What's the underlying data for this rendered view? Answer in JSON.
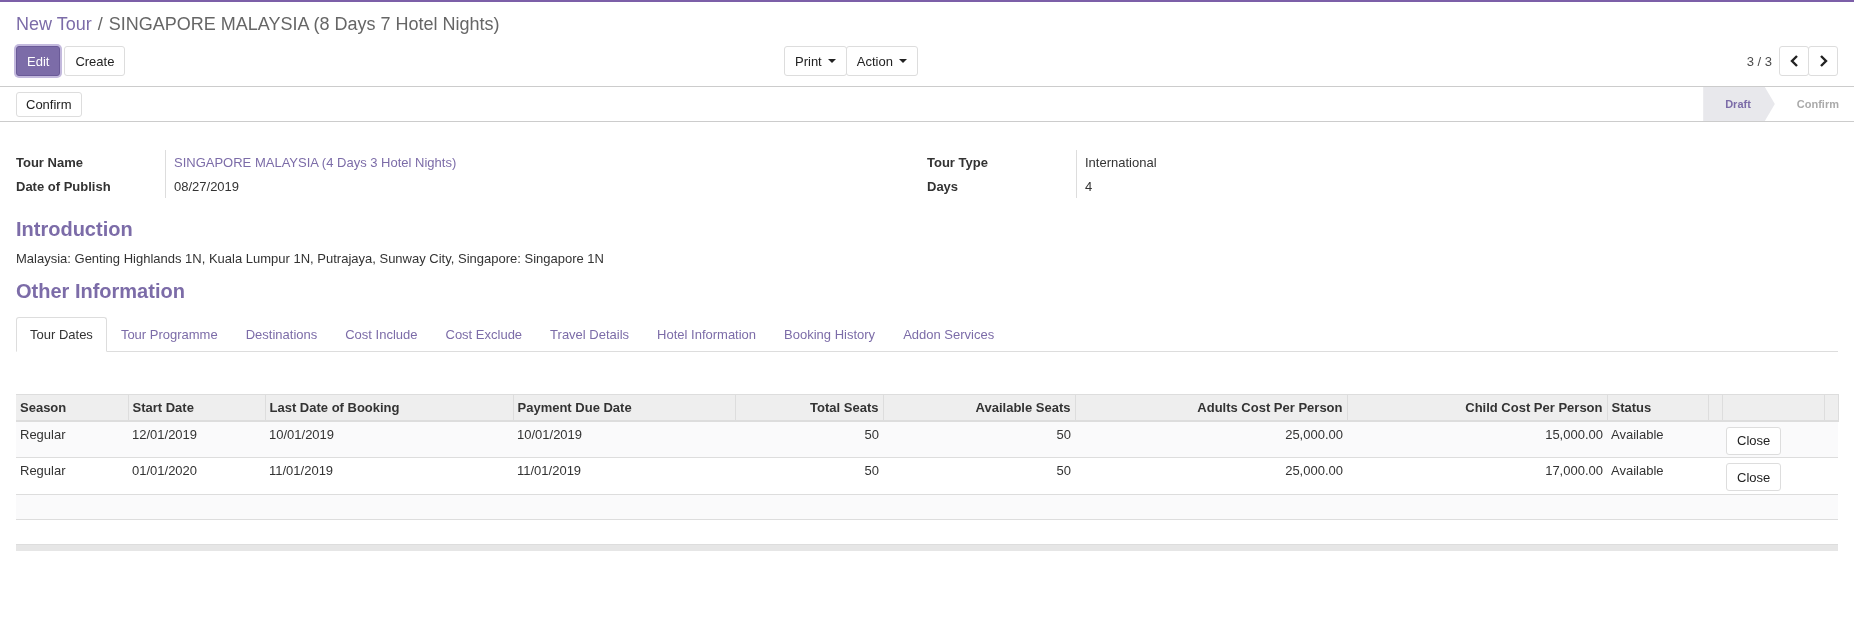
{
  "breadcrumb": {
    "parent": "New Tour",
    "separator": "/",
    "current": "SINGAPORE MALAYSIA (8 Days 7 Hotel Nights)"
  },
  "buttons": [
    {
      "label": "Edit",
      "kind": "primary"
    },
    {
      "label": "Create",
      "kind": "secondary"
    }
  ],
  "menus": [
    {
      "label": "Print"
    },
    {
      "label": "Action"
    }
  ],
  "pager": {
    "value": "3 / 3"
  },
  "header_buttons": [
    "Confirm"
  ],
  "stages": [
    {
      "label": "Draft",
      "selected": true
    },
    {
      "label": "Confirm",
      "selected": false
    }
  ],
  "fields_left": [
    {
      "label": "Tour Name",
      "value": "SINGAPORE MALAYSIA (4 Days 3 Hotel Nights)",
      "kind": "link"
    },
    {
      "label": "Date of Publish",
      "value": "08/27/2019",
      "kind": "text"
    }
  ],
  "fields_right": [
    {
      "label": "Tour Type",
      "value": "International",
      "kind": "text"
    },
    {
      "label": "Days",
      "value": "4",
      "kind": "text"
    }
  ],
  "introduction": {
    "title": "Introduction",
    "text": "Malaysia: Genting Highlands 1N, Kuala Lumpur 1N, Putrajaya, Sunway City, Singapore: Singapore 1N"
  },
  "other_title": "Other Information",
  "tabs": [
    {
      "label": "Tour Dates",
      "selected": true
    },
    {
      "label": "Tour Programme",
      "selected": false
    },
    {
      "label": "Destinations",
      "selected": false
    },
    {
      "label": "Cost Include",
      "selected": false
    },
    {
      "label": "Cost Exclude",
      "selected": false
    },
    {
      "label": "Travel Details",
      "selected": false
    },
    {
      "label": "Hotel Information",
      "selected": false
    },
    {
      "label": "Booking History",
      "selected": false
    },
    {
      "label": "Addon Services",
      "selected": false
    }
  ],
  "table": {
    "columns": [
      {
        "label": "Season",
        "kind": "text"
      },
      {
        "label": "Start Date",
        "kind": "text"
      },
      {
        "label": "Last Date of Booking",
        "kind": "text"
      },
      {
        "label": "Payment Due Date",
        "kind": "text"
      },
      {
        "label": "Total Seats",
        "kind": "number"
      },
      {
        "label": "Available Seats",
        "kind": "number"
      },
      {
        "label": "Adults Cost Per Person",
        "kind": "number"
      },
      {
        "label": "Child Cost Per Person",
        "kind": "number"
      },
      {
        "label": "Status",
        "kind": "text"
      }
    ],
    "rows": [
      {
        "cells": [
          "Regular",
          "12/01/2019",
          "10/01/2019",
          "10/01/2019",
          "50",
          "50",
          "25,000.00",
          "15,000.00",
          "Available"
        ],
        "action": "Close"
      },
      {
        "cells": [
          "Regular",
          "01/01/2020",
          "11/01/2019",
          "11/01/2019",
          "50",
          "50",
          "25,000.00",
          "17,000.00",
          "Available"
        ],
        "action": "Close"
      }
    ]
  }
}
